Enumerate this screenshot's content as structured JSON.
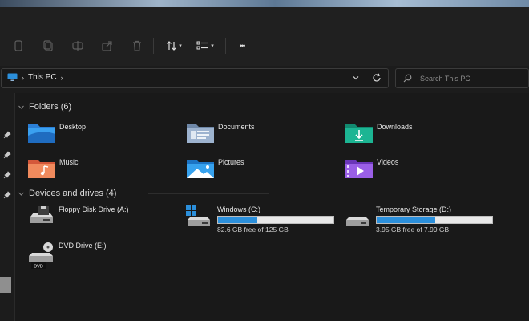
{
  "toolbar": {
    "buttons": [
      "cut-icon",
      "copy-icon",
      "rename-icon",
      "share-icon",
      "delete-icon",
      "sort-icon",
      "view-icon",
      "more-icon"
    ],
    "more_label": "•••"
  },
  "address": {
    "location": "This PC",
    "separator": "›"
  },
  "search": {
    "placeholder": "Search This PC"
  },
  "sections": {
    "folders_title": "Folders (6)",
    "devices_title": "Devices and drives (4)"
  },
  "folders": [
    {
      "label": "Desktop",
      "icon": "desktop-folder-icon",
      "color": "#1f7ad6"
    },
    {
      "label": "Documents",
      "icon": "documents-folder-icon",
      "color": "#8aa4c2"
    },
    {
      "label": "Downloads",
      "icon": "downloads-folder-icon",
      "color": "#1aa58a"
    },
    {
      "label": "Music",
      "icon": "music-folder-icon",
      "color": "#e8734a"
    },
    {
      "label": "Pictures",
      "icon": "pictures-folder-icon",
      "color": "#2a93e0"
    },
    {
      "label": "Videos",
      "icon": "videos-folder-icon",
      "color": "#8a4fd8"
    }
  ],
  "drives": [
    {
      "name": "Floppy Disk Drive (A:)",
      "icon": "floppy-drive-icon"
    },
    {
      "name": "Windows (C:)",
      "icon": "windows-drive-icon",
      "free": "82.6 GB free of 125 GB",
      "used_fraction": 0.34
    },
    {
      "name": "Temporary Storage (D:)",
      "icon": "hard-drive-icon",
      "free": "3.95 GB free of 7.99 GB",
      "used_fraction": 0.51
    },
    {
      "name": "DVD Drive (E:)",
      "icon": "dvd-drive-icon",
      "disc_label": "DVD"
    }
  ],
  "colors": {
    "accent": "#2b8fdb",
    "background": "#191919"
  }
}
